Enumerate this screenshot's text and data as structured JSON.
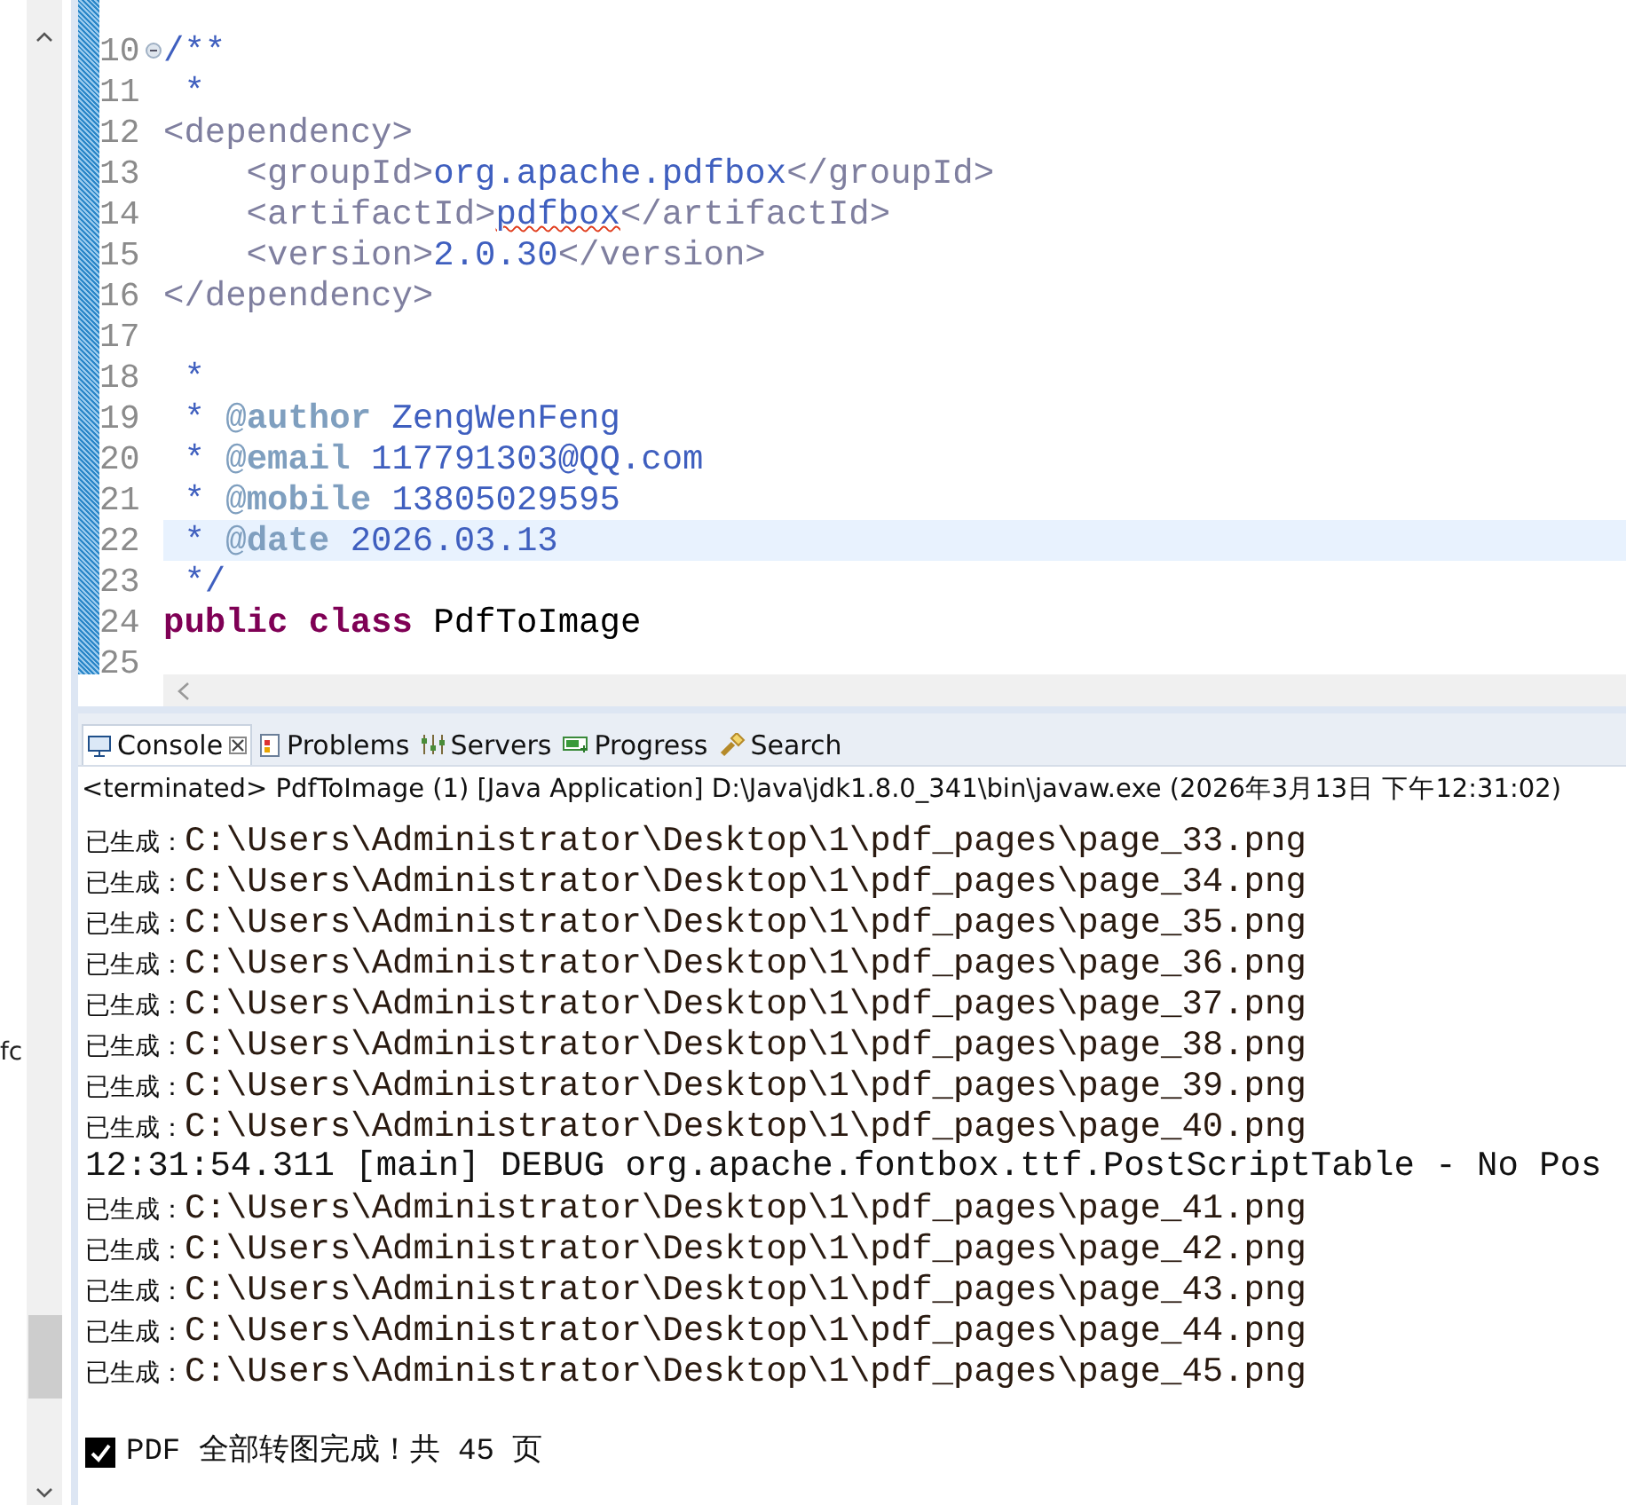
{
  "side_panel": {
    "clipped_text": "fc"
  },
  "editor": {
    "lines": [
      {
        "number": "10",
        "folded": false,
        "tokens": [
          {
            "kind": "doc",
            "text": "/**"
          }
        ]
      },
      {
        "number": "11",
        "tokens": [
          {
            "kind": "doc",
            "text": " *"
          }
        ]
      },
      {
        "number": "12",
        "tokens": [
          {
            "kind": "tag",
            "text": "<dependency>"
          }
        ]
      },
      {
        "number": "13",
        "tokens": [
          {
            "kind": "tag",
            "text": "    <groupId>"
          },
          {
            "kind": "doc",
            "text": "org.apache.pdfbox"
          },
          {
            "kind": "tag",
            "text": "</groupId>"
          }
        ]
      },
      {
        "number": "14",
        "tokens": [
          {
            "kind": "tag",
            "text": "    <artifactId>"
          },
          {
            "kind": "misspelled",
            "text": "pdfbox"
          },
          {
            "kind": "tag",
            "text": "</artifactId>"
          }
        ]
      },
      {
        "number": "15",
        "tokens": [
          {
            "kind": "tag",
            "text": "    <version>"
          },
          {
            "kind": "doc",
            "text": "2.0.30"
          },
          {
            "kind": "tag",
            "text": "</version>"
          }
        ]
      },
      {
        "number": "16",
        "tokens": [
          {
            "kind": "tag",
            "text": "</dependency>"
          }
        ]
      },
      {
        "number": "17"
      },
      {
        "number": "18",
        "tokens": [
          {
            "kind": "doc",
            "text": " *"
          }
        ]
      },
      {
        "number": "19",
        "tokens": [
          {
            "kind": "doc",
            "text": " * "
          },
          {
            "kind": "at",
            "text": "@"
          },
          {
            "kind": "doctag",
            "text": "author"
          },
          {
            "kind": "doc",
            "text": " ZengWenFeng"
          }
        ]
      },
      {
        "number": "20",
        "tokens": [
          {
            "kind": "doc",
            "text": " * "
          },
          {
            "kind": "at",
            "text": "@"
          },
          {
            "kind": "doctag",
            "text": "email"
          },
          {
            "kind": "doc",
            "text": " 117791303@QQ.com"
          }
        ]
      },
      {
        "number": "21",
        "tokens": [
          {
            "kind": "doc",
            "text": " * "
          },
          {
            "kind": "at",
            "text": "@"
          },
          {
            "kind": "doctag",
            "text": "mobile"
          },
          {
            "kind": "doc",
            "text": " 13805029595"
          }
        ]
      },
      {
        "number": "22",
        "current": true,
        "tokens": [
          {
            "kind": "doc",
            "text": " * "
          },
          {
            "kind": "at",
            "text": "@"
          },
          {
            "kind": "doctag",
            "text": "date"
          },
          {
            "kind": "doc",
            "text": " 2026.03.13"
          }
        ]
      },
      {
        "number": "23",
        "tokens": [
          {
            "kind": "doc",
            "text": " */"
          }
        ]
      },
      {
        "number": "24",
        "tokens": [
          {
            "kind": "keyword",
            "text": "public class"
          },
          {
            "kind": "plain",
            "text": " PdfToImage"
          }
        ]
      },
      {
        "number": "25"
      }
    ]
  },
  "console": {
    "tabs": [
      {
        "label": "Console",
        "selected": true,
        "closable": true
      },
      {
        "label": "Problems",
        "selected": false,
        "closable": false
      },
      {
        "label": "Servers",
        "selected": false,
        "closable": false
      },
      {
        "label": "Progress",
        "selected": false,
        "closable": false
      },
      {
        "label": "Search",
        "selected": false,
        "closable": false
      }
    ],
    "status": "<terminated> PdfToImage (1) [Java Application] D:\\Java\\jdk1.8.0_341\\bin\\javaw.exe (2026年3月13日 下午12:31:02)",
    "lines": [
      {
        "kind": "generated",
        "label": "已生成：",
        "path": "C:\\Users\\Administrator\\Desktop\\1\\pdf_pages\\page_33.png"
      },
      {
        "kind": "generated",
        "label": "已生成：",
        "path": "C:\\Users\\Administrator\\Desktop\\1\\pdf_pages\\page_34.png"
      },
      {
        "kind": "generated",
        "label": "已生成：",
        "path": "C:\\Users\\Administrator\\Desktop\\1\\pdf_pages\\page_35.png"
      },
      {
        "kind": "generated",
        "label": "已生成：",
        "path": "C:\\Users\\Administrator\\Desktop\\1\\pdf_pages\\page_36.png"
      },
      {
        "kind": "generated",
        "label": "已生成：",
        "path": "C:\\Users\\Administrator\\Desktop\\1\\pdf_pages\\page_37.png"
      },
      {
        "kind": "generated",
        "label": "已生成：",
        "path": "C:\\Users\\Administrator\\Desktop\\1\\pdf_pages\\page_38.png"
      },
      {
        "kind": "generated",
        "label": "已生成：",
        "path": "C:\\Users\\Administrator\\Desktop\\1\\pdf_pages\\page_39.png"
      },
      {
        "kind": "generated",
        "label": "已生成：",
        "path": "C:\\Users\\Administrator\\Desktop\\1\\pdf_pages\\page_40.png"
      },
      {
        "kind": "log",
        "text": "12:31:54.311 [main] DEBUG org.apache.fontbox.ttf.PostScriptTable - No Pos"
      },
      {
        "kind": "generated",
        "label": "已生成：",
        "path": "C:\\Users\\Administrator\\Desktop\\1\\pdf_pages\\page_41.png"
      },
      {
        "kind": "generated",
        "label": "已生成：",
        "path": "C:\\Users\\Administrator\\Desktop\\1\\pdf_pages\\page_42.png"
      },
      {
        "kind": "generated",
        "label": "已生成：",
        "path": "C:\\Users\\Administrator\\Desktop\\1\\pdf_pages\\page_43.png"
      },
      {
        "kind": "generated",
        "label": "已生成：",
        "path": "C:\\Users\\Administrator\\Desktop\\1\\pdf_pages\\page_44.png"
      },
      {
        "kind": "generated",
        "label": "已生成：",
        "path": "C:\\Users\\Administrator\\Desktop\\1\\pdf_pages\\page_45.png"
      },
      {
        "kind": "done",
        "text": "PDF 全部转图完成！共 45 页"
      }
    ]
  }
}
